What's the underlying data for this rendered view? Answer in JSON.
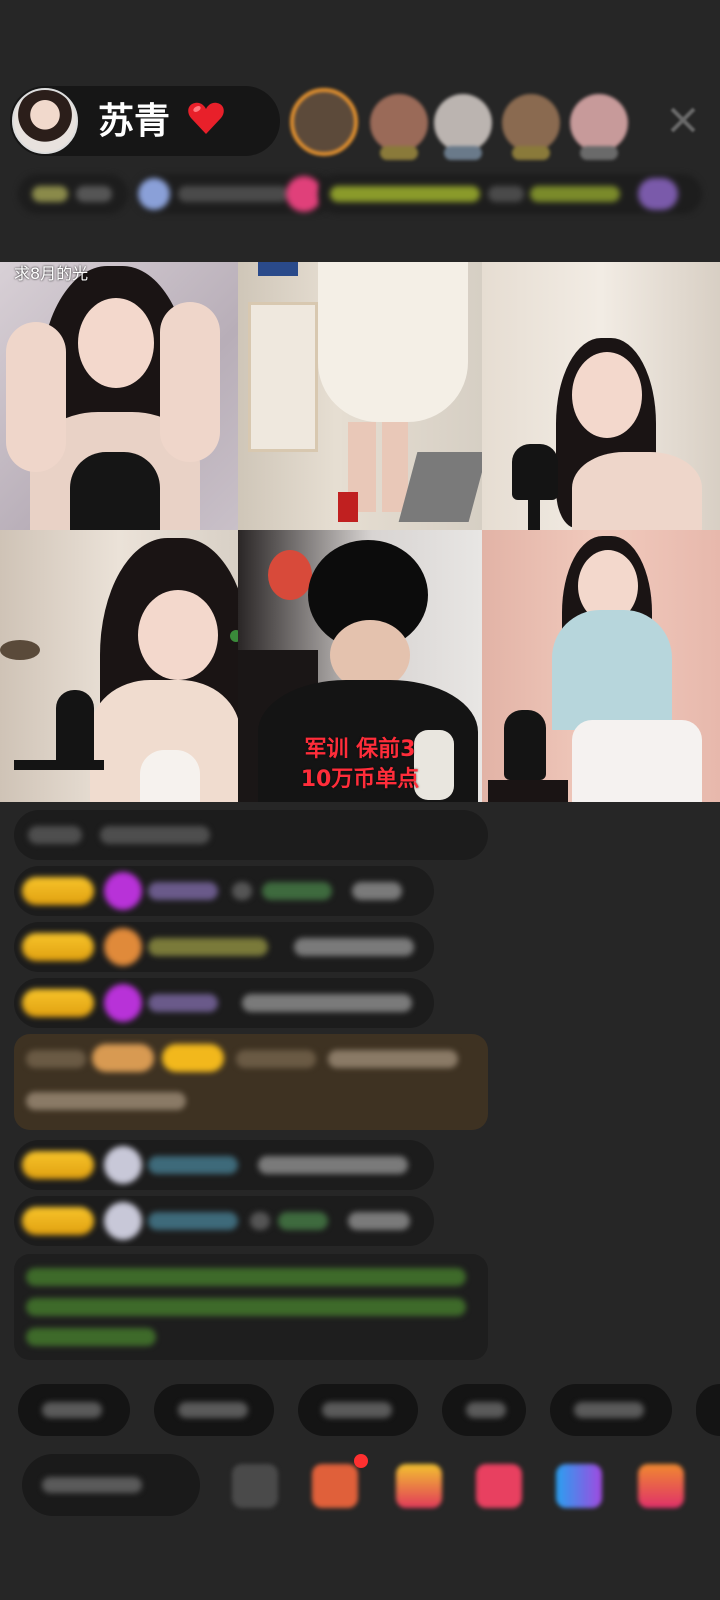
{
  "host": {
    "name": "苏青",
    "heart": "❤️"
  },
  "video": {
    "tile1_label": "求8月的光",
    "tile5_overlay_line1": "军训 保前3",
    "tile5_overlay_line2": "10万币单点"
  },
  "colors": {
    "background": "#262626",
    "gift_badge": "#f2b81c",
    "overlay_red": "#ff2d3a",
    "close_icon": "#6a6a6a"
  },
  "icons": {
    "heart": "red-heart-icon",
    "close": "close-icon"
  }
}
